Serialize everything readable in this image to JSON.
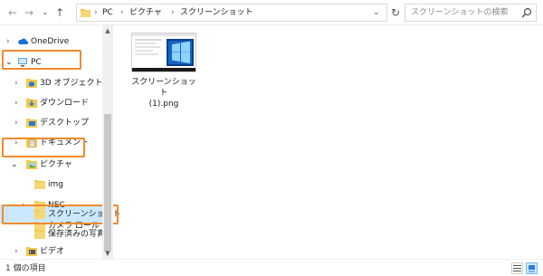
{
  "navigation": {
    "back_icon": "back-arrow-icon",
    "forward_icon": "forward-arrow-icon",
    "recent_icon": "chevron-down-icon",
    "up_icon": "up-arrow-icon",
    "refresh_icon": "refresh-icon"
  },
  "address": {
    "crumbs": [
      "PC",
      "ピクチャ",
      "スクリーンショット"
    ],
    "separator": "›"
  },
  "search": {
    "placeholder": "スクリーンショットの検索"
  },
  "tree": {
    "items": [
      {
        "label": "OneDrive",
        "icon": "cloud-icon",
        "expanded": false
      },
      {
        "label": "PC",
        "icon": "computer-icon",
        "expanded": true,
        "highlighted": true
      },
      {
        "label": "3D オブジェクト",
        "icon": "3d-objects-icon",
        "expanded": false
      },
      {
        "label": "ダウンロード",
        "icon": "download-folder-icon",
        "expanded": false
      },
      {
        "label": "デスクトップ",
        "icon": "desktop-folder-icon",
        "expanded": false
      },
      {
        "label": "ドキュメント",
        "icon": "documents-folder-icon",
        "expanded": false
      },
      {
        "label": "ピクチャ",
        "icon": "pictures-folder-icon",
        "expanded": true,
        "highlighted": true
      },
      {
        "label": "img",
        "icon": "folder-icon"
      },
      {
        "label": "NEC",
        "icon": "folder-icon",
        "expanded": false
      },
      {
        "label": "カメラ ロール",
        "icon": "folder-icon"
      },
      {
        "label": "スクリーンショット",
        "icon": "folder-icon",
        "selected": true,
        "highlighted": true
      },
      {
        "label": "保存済みの写真",
        "icon": "folder-icon"
      },
      {
        "label": "ビデオ",
        "icon": "videos-folder-icon",
        "expanded": false
      }
    ]
  },
  "files": [
    {
      "name": "スクリーンショット (1).png",
      "name_line1": "スクリーンショット",
      "name_line2": "(1).png"
    }
  ],
  "status": {
    "item_count": "1 個の項目"
  },
  "colors": {
    "highlight_outline": "#f28a2b",
    "selection_bg": "#cce8ff",
    "folder_yellow": "#f2c94c"
  }
}
